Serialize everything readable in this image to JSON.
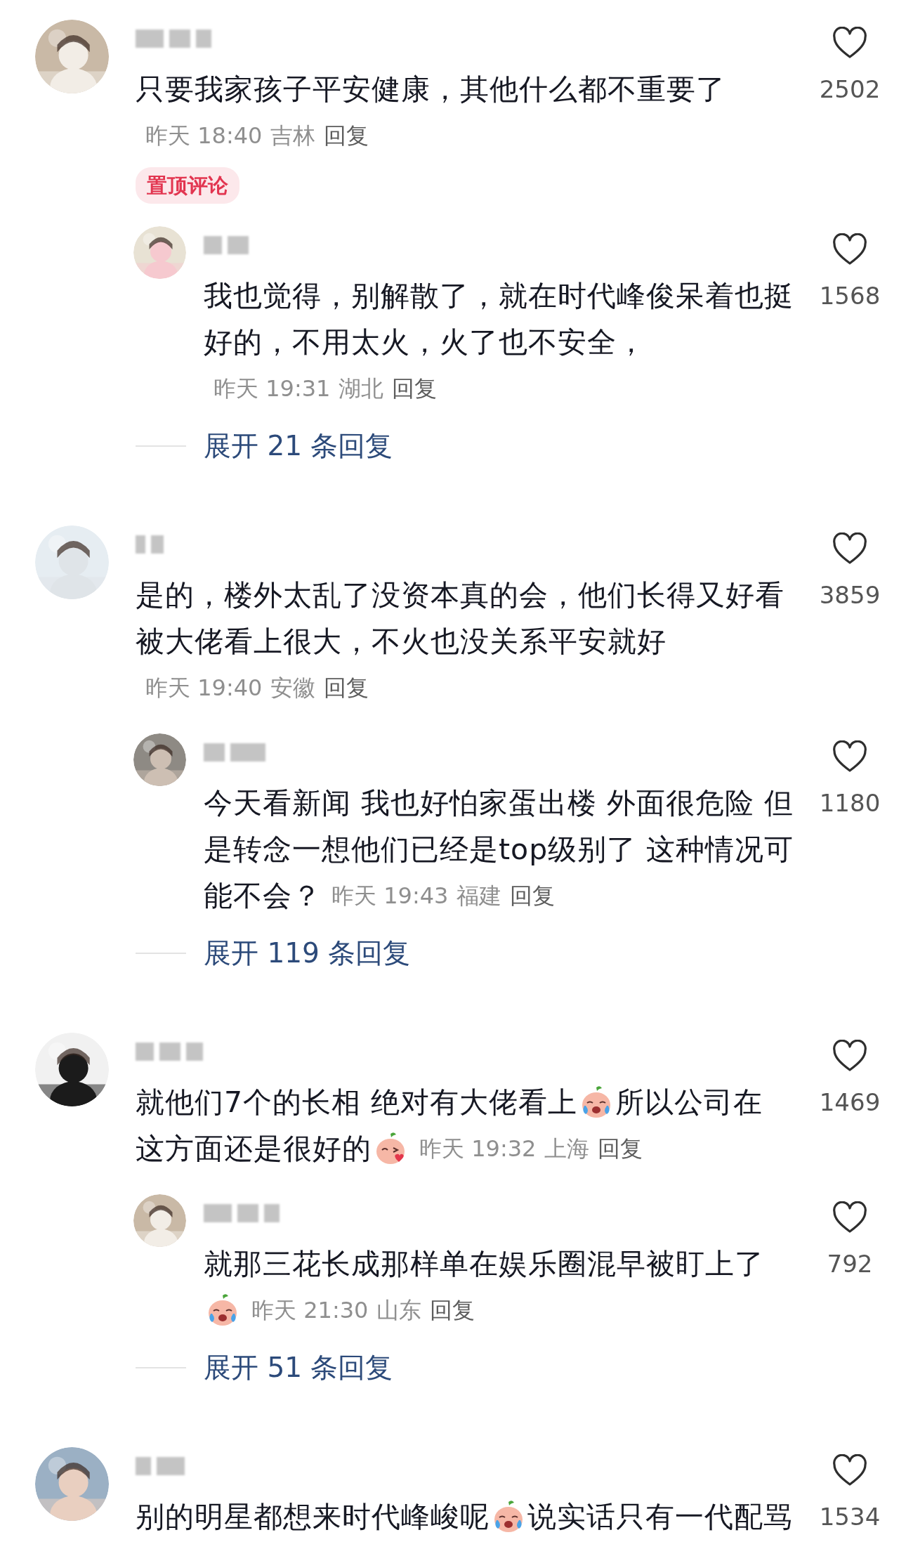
{
  "comments": [
    {
      "lines": [
        [
          {
            "kind": "text",
            "text": "只要我家孩子平安健康，其他什么都不重要了"
          }
        ]
      ],
      "time": "昨天 18:40",
      "location": "吉林",
      "reply_label": "回复",
      "likes": "2502",
      "pinned_label": "置顶评论",
      "replies": [
        {
          "lines": [
            [
              {
                "kind": "text",
                "text": "我也觉得，别解散了，就在时代峰俊呆着也挺"
              }
            ],
            [
              {
                "kind": "text",
                "text": "好的，不用太火，火了也不安全，"
              }
            ]
          ],
          "time": "昨天 19:31",
          "location": "湖北",
          "reply_label": "回复",
          "likes": "1568"
        }
      ],
      "expand": "展开 21 条回复"
    },
    {
      "lines": [
        [
          {
            "kind": "text",
            "text": "是的，楼外太乱了没资本真的会，他们长得又好看"
          }
        ],
        [
          {
            "kind": "text",
            "text": "被大佬看上很大，不火也没关系平安就好"
          }
        ]
      ],
      "time": "昨天 19:40",
      "location": "安徽",
      "reply_label": "回复",
      "likes": "3859",
      "replies": [
        {
          "lines": [
            [
              {
                "kind": "text",
                "text": "今天看新闻 我也好怕家蛋出楼 外面很危险 但"
              }
            ],
            [
              {
                "kind": "text",
                "text": "是转念一想他们已经是top级别了 这种情况可"
              }
            ],
            [
              {
                "kind": "text",
                "text": "能不会？"
              }
            ]
          ],
          "time": "昨天 19:43",
          "location": "福建",
          "reply_label": "回复",
          "likes": "1180"
        }
      ],
      "expand": "展开 119 条回复"
    },
    {
      "lines": [
        [
          {
            "kind": "text",
            "text": "就他们7个的长相 绝对有大佬看上"
          },
          {
            "kind": "crying-emoji"
          },
          {
            "kind": "text",
            "text": "所以公司在"
          }
        ],
        [
          {
            "kind": "text",
            "text": "这方面还是很好的"
          },
          {
            "kind": "kissing-emoji"
          }
        ]
      ],
      "time": "昨天 19:32",
      "location": "上海",
      "reply_label": "回复",
      "likes": "1469",
      "replies": [
        {
          "lines": [
            [
              {
                "kind": "text",
                "text": "就那三花长成那样单在娱乐圈混早被盯上了"
              }
            ],
            [
              {
                "kind": "crying-emoji"
              }
            ]
          ],
          "time": "昨天 21:30",
          "location": "山东",
          "reply_label": "回复",
          "likes": "792"
        }
      ],
      "expand": "展开 51 条回复"
    },
    {
      "lines": [
        [
          {
            "kind": "text",
            "text": "别的明星都想来时代峰峻呢"
          },
          {
            "kind": "crying-emoji"
          },
          {
            "kind": "text",
            "text": "说实话只有一代配骂"
          }
        ]
      ],
      "likes": "1534"
    }
  ]
}
